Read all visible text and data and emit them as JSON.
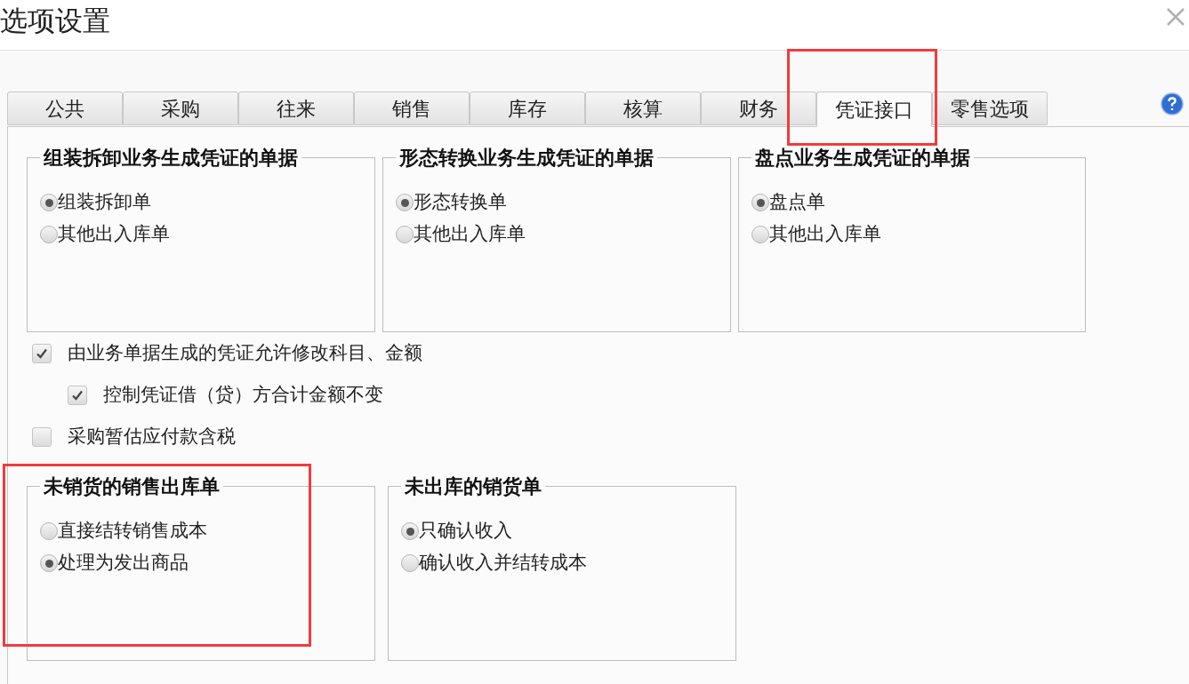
{
  "dialog": {
    "title": "选项设置"
  },
  "tabs": [
    {
      "label": "公共",
      "selected": false
    },
    {
      "label": "采购",
      "selected": false
    },
    {
      "label": "往来",
      "selected": false
    },
    {
      "label": "销售",
      "selected": false
    },
    {
      "label": "库存",
      "selected": false
    },
    {
      "label": "核算",
      "selected": false
    },
    {
      "label": "财务",
      "selected": false
    },
    {
      "label": "凭证接口",
      "selected": true
    },
    {
      "label": "零售选项",
      "selected": false
    }
  ],
  "groups": [
    {
      "title": "组装拆卸业务生成凭证的单据",
      "options": [
        {
          "label": "组装拆卸单",
          "selected": true
        },
        {
          "label": "其他出入库单",
          "selected": false
        }
      ]
    },
    {
      "title": "形态转换业务生成凭证的单据",
      "options": [
        {
          "label": "形态转换单",
          "selected": true
        },
        {
          "label": "其他出入库单",
          "selected": false
        }
      ]
    },
    {
      "title": "盘点业务生成凭证的单据",
      "options": [
        {
          "label": "盘点单",
          "selected": true
        },
        {
          "label": "其他出入库单",
          "selected": false
        }
      ]
    }
  ],
  "checkboxes": [
    {
      "label": "由业务单据生成的凭证允许修改科目、金额",
      "checked": true,
      "children": [
        {
          "label": "控制凭证借（贷）方合计金额不变",
          "checked": true
        }
      ]
    },
    {
      "label": "采购暂估应付款含税",
      "checked": false
    }
  ],
  "bottom_groups": [
    {
      "title": "未销货的销售出库单",
      "options": [
        {
          "label": "直接结转销售成本",
          "selected": false
        },
        {
          "label": "处理为发出商品",
          "selected": true
        }
      ]
    },
    {
      "title": "未出库的销货单",
      "options": [
        {
          "label": "只确认收入",
          "selected": true
        },
        {
          "label": "确认收入并结转成本",
          "selected": false
        }
      ]
    }
  ]
}
